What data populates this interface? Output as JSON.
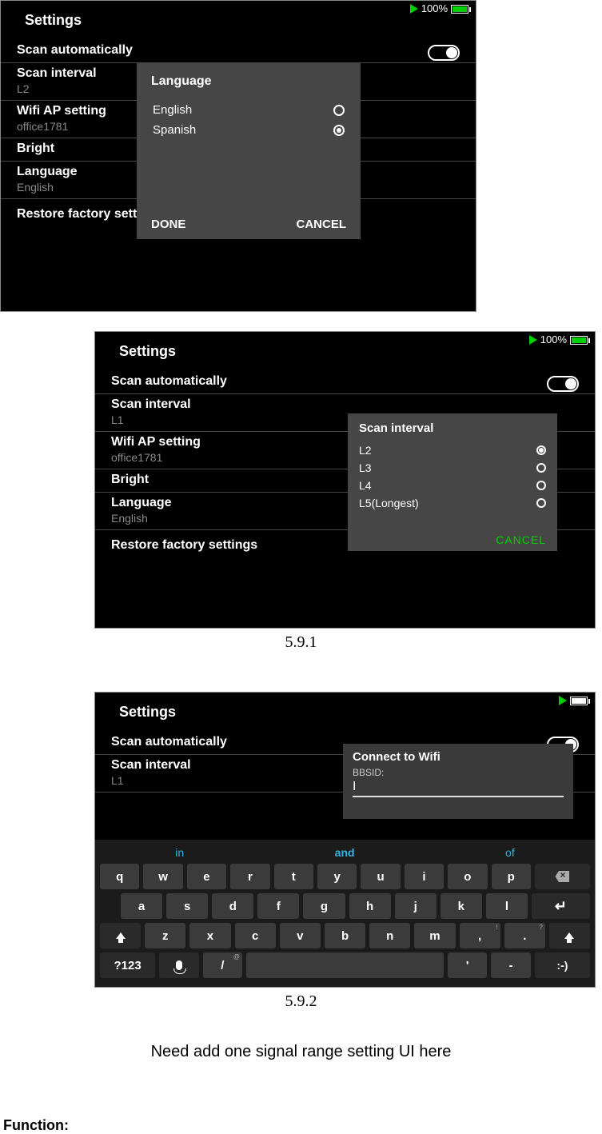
{
  "screen1": {
    "status": {
      "battery": "100%"
    },
    "title": "Settings",
    "rows": {
      "scan_auto": "Scan automatically",
      "scan_interval": {
        "label": "Scan interval",
        "value": "L2"
      },
      "wifi": {
        "label": "Wifi AP setting",
        "value": "office1781"
      },
      "bright": "Bright",
      "language": {
        "label": "Language",
        "value": "English"
      },
      "restore": "Restore factory settings"
    },
    "modal": {
      "title": "Language",
      "options": [
        "English",
        "Spanish"
      ],
      "selected": 1,
      "done": "DONE",
      "cancel": "CANCEL"
    }
  },
  "screen2": {
    "status": {
      "battery": "100%"
    },
    "title": "Settings",
    "rows": {
      "scan_auto": "Scan automatically",
      "scan_interval": {
        "label": "Scan interval",
        "value": "L1"
      },
      "wifi": {
        "label": "Wifi AP setting",
        "value": "office1781"
      },
      "bright": "Bright",
      "language": {
        "label": "Language",
        "value": "English"
      },
      "restore": "Restore factory settings"
    },
    "modal": {
      "title": "Scan interval",
      "options": [
        "L2",
        "L3",
        "L4",
        "L5(Longest)"
      ],
      "selected": 0,
      "cancel": "CANCEL"
    },
    "caption": "5.9.1"
  },
  "screen3": {
    "title": "Settings",
    "rows": {
      "scan_auto": "Scan automatically",
      "scan_interval": {
        "label": "Scan interval",
        "value": "L1"
      }
    },
    "modal": {
      "title": "Connect to Wifi",
      "field_label": "BBSID:",
      "input_value": "I"
    },
    "keyboard": {
      "suggestions": [
        "in",
        "and",
        "of"
      ],
      "row1": [
        "q",
        "w",
        "e",
        "r",
        "t",
        "y",
        "u",
        "i",
        "o",
        "p"
      ],
      "row2": [
        "a",
        "s",
        "d",
        "f",
        "g",
        "h",
        "j",
        "k",
        "l"
      ],
      "row3": [
        "z",
        "x",
        "c",
        "v",
        "b",
        "n",
        "m",
        ",",
        "."
      ],
      "sym": "?123",
      "slash": "/",
      "slash_sup": "@",
      "apos": "'",
      "dash": "-",
      "smile": ":-)",
      "comma_sup": "!",
      "period_sup": "?"
    },
    "caption": "5.9.2"
  },
  "note": "Need add one signal range setting UI here",
  "function_heading": "Function:"
}
